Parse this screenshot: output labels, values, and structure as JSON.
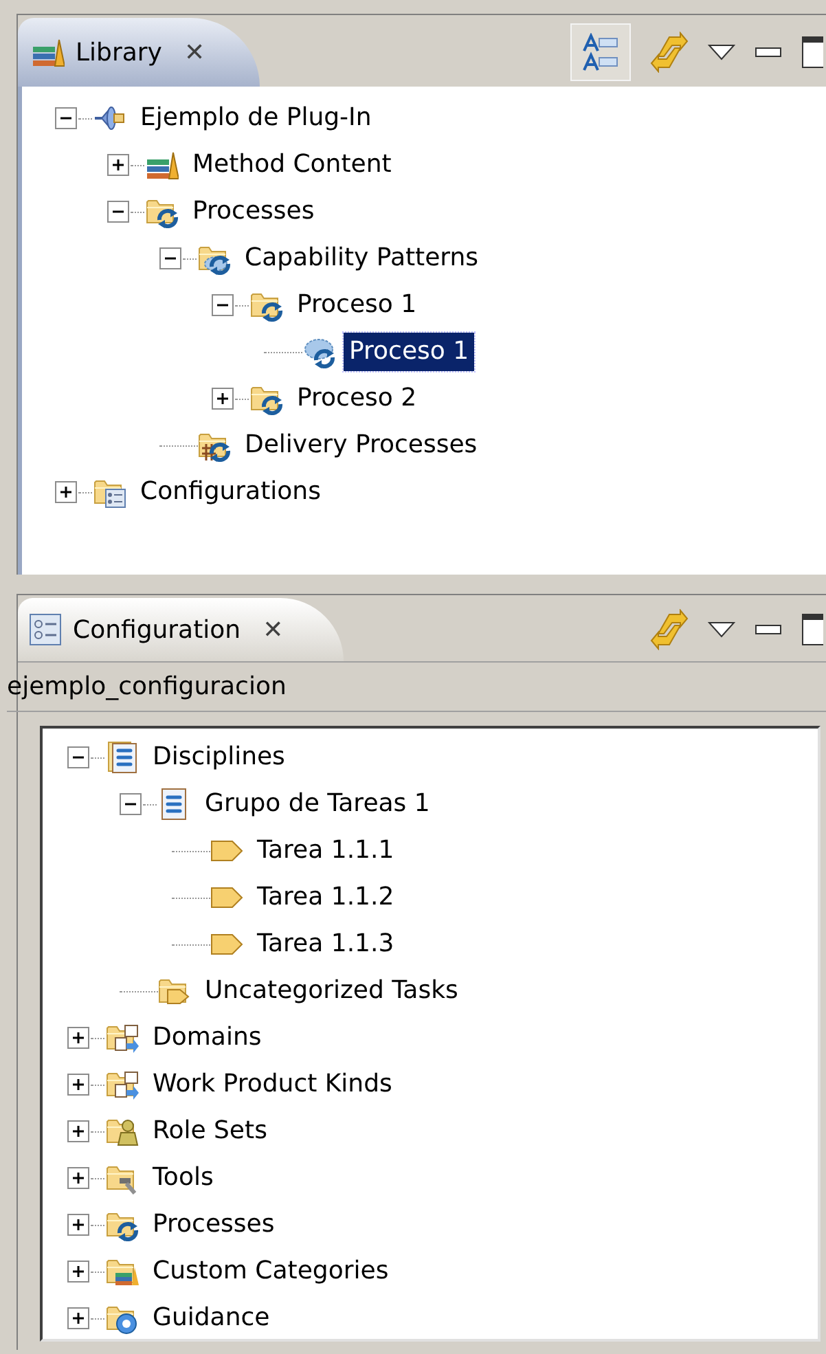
{
  "library_view": {
    "tab": {
      "label": "Library",
      "close": "✕"
    },
    "tree": [
      {
        "label": "Ejemplo de Plug-In",
        "kind": "plugin",
        "expanded": true,
        "selected": false,
        "children": [
          {
            "label": "Method Content",
            "kind": "library",
            "expanded": false,
            "selected": false
          },
          {
            "label": "Processes",
            "kind": "process-folder",
            "expanded": true,
            "selected": false,
            "children": [
              {
                "label": "Capability Patterns",
                "kind": "pattern-folder",
                "expanded": true,
                "selected": false,
                "children": [
                  {
                    "label": "Proceso 1",
                    "kind": "process-folder",
                    "expanded": true,
                    "selected": false,
                    "children": [
                      {
                        "label": "Proceso 1",
                        "kind": "pattern",
                        "selected": true
                      }
                    ]
                  },
                  {
                    "label": "Proceso 2",
                    "kind": "process-folder",
                    "expanded": false,
                    "selected": false
                  }
                ]
              },
              {
                "label": "Delivery Processes",
                "kind": "delivery-folder",
                "selected": false
              }
            ]
          }
        ]
      },
      {
        "label": "Configurations",
        "kind": "config-folder",
        "expanded": false,
        "selected": false
      }
    ]
  },
  "configuration_view": {
    "tab": {
      "label": "Configuration",
      "close": "✕"
    },
    "configuration_name": "ejemplo_configuracion",
    "tree": [
      {
        "label": "Disciplines",
        "kind": "discipline-folder",
        "expanded": true,
        "selected": false,
        "children": [
          {
            "label": "Grupo de Tareas 1",
            "kind": "discipline",
            "expanded": true,
            "selected": false,
            "children": [
              {
                "label": "Tarea 1.1.1",
                "kind": "task",
                "selected": false
              },
              {
                "label": "Tarea 1.1.2",
                "kind": "task",
                "selected": false
              },
              {
                "label": "Tarea 1.1.3",
                "kind": "task",
                "selected": false
              }
            ]
          },
          {
            "label": "Uncategorized Tasks",
            "kind": "task-folder",
            "selected": false
          }
        ]
      },
      {
        "label": "Domains",
        "kind": "domain-folder",
        "expanded": false,
        "selected": false
      },
      {
        "label": "Work Product Kinds",
        "kind": "domain-folder",
        "expanded": false,
        "selected": false
      },
      {
        "label": "Role Sets",
        "kind": "role-folder",
        "expanded": false,
        "selected": false
      },
      {
        "label": "Tools",
        "kind": "tool-folder",
        "expanded": false,
        "selected": false
      },
      {
        "label": "Processes",
        "kind": "process-folder",
        "expanded": false,
        "selected": false
      },
      {
        "label": "Custom Categories",
        "kind": "category-folder",
        "expanded": false,
        "selected": false
      },
      {
        "label": "Guidance",
        "kind": "guidance-folder",
        "expanded": false,
        "selected": false
      }
    ]
  }
}
